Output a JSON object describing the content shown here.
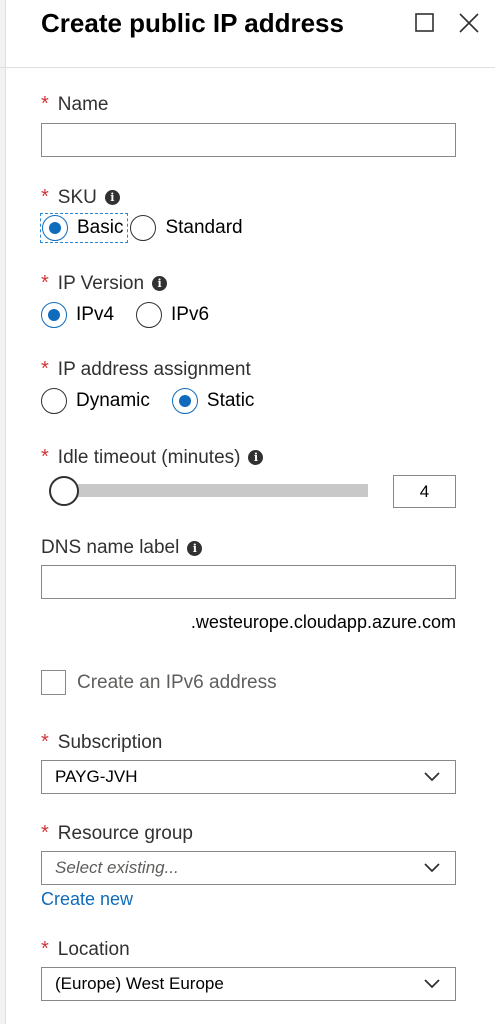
{
  "header": {
    "title": "Create public IP address"
  },
  "name": {
    "label": "Name",
    "required_mark": "*",
    "value": ""
  },
  "sku": {
    "label": "SKU",
    "required_mark": "*",
    "options": [
      {
        "label": "Basic",
        "checked": true
      },
      {
        "label": "Standard",
        "checked": false
      }
    ]
  },
  "ip_version": {
    "label": "IP Version",
    "required_mark": "*",
    "options": [
      {
        "label": "IPv4",
        "checked": true
      },
      {
        "label": "IPv6",
        "checked": false
      }
    ]
  },
  "assignment": {
    "label": "IP address assignment",
    "required_mark": "*",
    "options": [
      {
        "label": "Dynamic",
        "checked": false
      },
      {
        "label": "Static",
        "checked": true
      }
    ]
  },
  "idle_timeout": {
    "label": "Idle timeout (minutes)",
    "required_mark": "*",
    "value": "4"
  },
  "dns": {
    "label": "DNS name label",
    "value": "",
    "suffix": ".westeurope.cloudapp.azure.com"
  },
  "ipv6_checkbox": {
    "label": "Create an IPv6 address",
    "checked": false
  },
  "subscription": {
    "label": "Subscription",
    "required_mark": "*",
    "value": "PAYG-JVH"
  },
  "resource_group": {
    "label": "Resource group",
    "required_mark": "*",
    "placeholder": "Select existing...",
    "create_new": "Create new"
  },
  "location": {
    "label": "Location",
    "required_mark": "*",
    "value": "(Europe) West Europe"
  },
  "colors": {
    "accent": "#0f6cbd",
    "required": "#d13438",
    "border": "#8a8886"
  },
  "icons": {
    "info": "info-icon",
    "chevron": "chevron-down-icon",
    "maximize": "maximize-icon",
    "close": "close-icon"
  }
}
